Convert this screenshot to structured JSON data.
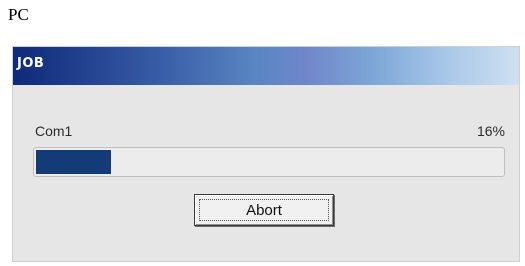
{
  "caption": "PC",
  "window": {
    "title": "JOB"
  },
  "job": {
    "port": "Com1",
    "percent_text": "16%",
    "progress": 0.16,
    "abort_label": "Abort"
  },
  "colors": {
    "progress_fill": "#123b78",
    "dialog_background": "#e6e6e6"
  }
}
